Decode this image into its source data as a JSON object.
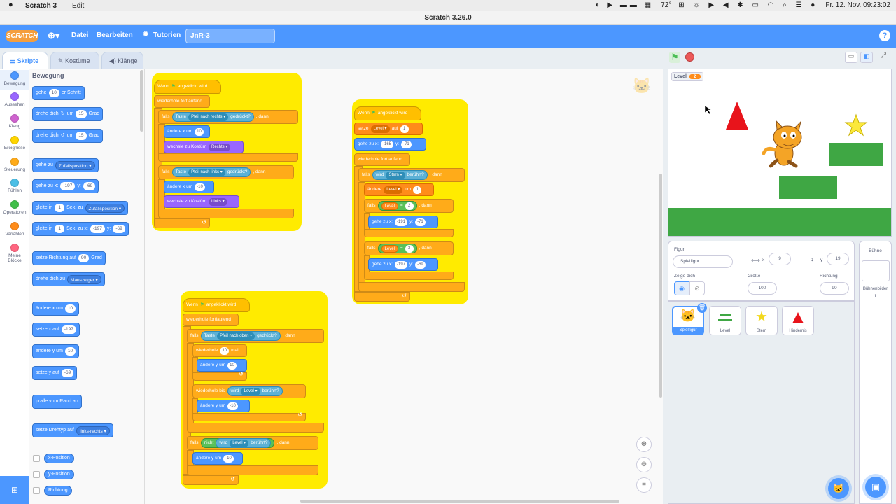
{
  "mac": {
    "app": "Scratch 3",
    "edit": "Edit",
    "weather": "72°",
    "clock": "Fr. 12. Nov.  09:23:02"
  },
  "window": {
    "title": "Scratch 3.26.0"
  },
  "menu": {
    "logo": "SCRATCH",
    "file": "Datei",
    "edit": "Bearbeiten",
    "tutorials": "Tutorien",
    "project_title": "JnR-3",
    "help": "?"
  },
  "tabs": {
    "code": "Skripte",
    "costumes": "Kostüme",
    "sounds": "Klänge"
  },
  "categories": [
    {
      "label": "Bewegung",
      "color": "#4c97ff"
    },
    {
      "label": "Aussehen",
      "color": "#9966ff"
    },
    {
      "label": "Klang",
      "color": "#cf63cf"
    },
    {
      "label": "Ereignisse",
      "color": "#ffd500"
    },
    {
      "label": "Steuerung",
      "color": "#ffab19"
    },
    {
      "label": "Fühlen",
      "color": "#4cbfe6"
    },
    {
      "label": "Operatoren",
      "color": "#40bf4a"
    },
    {
      "label": "Variablen",
      "color": "#ff8c1a"
    },
    {
      "label": "Meine Blöcke",
      "color": "#ff6680"
    }
  ],
  "palette": {
    "heading": "Bewegung",
    "move": {
      "a": "gehe",
      "v": "10",
      "b": "er Schritt"
    },
    "turn_right": {
      "a": "drehe dich",
      "b": "um",
      "v": "15",
      "c": "Grad"
    },
    "turn_left": {
      "a": "drehe dich",
      "b": "um",
      "v": "15",
      "c": "Grad"
    },
    "goto": {
      "a": "gehe zu",
      "dd": "Zufallsposition"
    },
    "gotoxy": {
      "a": "gehe zu x:",
      "x": "-197",
      "b": "y:",
      "y": "-69"
    },
    "glide": {
      "a": "gleite in",
      "v": "1",
      "b": "Sek. zu",
      "dd": "Zufallsposition"
    },
    "glidexy": {
      "a": "gleite in",
      "v": "1",
      "b": "Sek. zu x:",
      "x": "-197",
      "c": "y:",
      "y": "-69"
    },
    "point": {
      "a": "setze Richtung auf",
      "v": "90",
      "b": "Grad"
    },
    "pointto": {
      "a": "drehe dich zu",
      "dd": "Mauszeiger"
    },
    "changex": {
      "a": "ändere x um",
      "v": "10"
    },
    "setx": {
      "a": "setze x auf",
      "v": "-197"
    },
    "changey": {
      "a": "ändere y um",
      "v": "10"
    },
    "sety": {
      "a": "setze y auf",
      "v": "-69"
    },
    "bounce": "pralle vom Rand ab",
    "rotstyle": {
      "a": "setze Drehtyp auf",
      "dd": "links-rechts"
    },
    "rep_x": "x-Position",
    "rep_y": "y-Position",
    "rep_dir": "Richtung"
  },
  "scripts": {
    "s1": {
      "hat": "Wenn",
      "hat2": "angeklickt wird",
      "forever": "wiederhole fortlaufend",
      "if1": {
        "a": "falls",
        "b": "Taste",
        "dd": "Pfeil nach rechts",
        "c": "gedrückt?",
        "d": ", dann"
      },
      "cx1": {
        "a": "ändere x um",
        "v": "10"
      },
      "cos1": {
        "a": "wechsle zu Kostüm",
        "dd": "Rechts"
      },
      "if2": {
        "a": "falls",
        "b": "Taste",
        "dd": "Pfeil nach links",
        "c": "gedrückt?",
        "d": ", dann"
      },
      "cx2": {
        "a": "ändere x um",
        "v": "-10"
      },
      "cos2": {
        "a": "wechsle zu Kostüm",
        "dd": "Links"
      }
    },
    "s2": {
      "hat": "Wenn",
      "hat2": "angeklickt wird",
      "set": {
        "a": "setze",
        "dd": "Level",
        "b": "auf",
        "v": "1"
      },
      "goto": {
        "a": "gehe zu x:",
        "x": "-165",
        "b": "y:",
        "y": "-71"
      },
      "forever": "wiederhole fortlaufend",
      "if1": {
        "a": "falls",
        "b": "wird",
        "dd": "Stern",
        "c": "berührt?",
        "d": ", dann"
      },
      "change": {
        "a": "ändere",
        "dd": "Level",
        "b": "um",
        "v": "1"
      },
      "if2": {
        "a": "falls",
        "var": "Level",
        "eq": "=",
        "v": "2",
        "d": ", dann"
      },
      "goto2": {
        "a": "gehe zu x:",
        "x": "-191",
        "b": "y:",
        "y": "-71"
      },
      "if3": {
        "a": "falls",
        "var": "Level",
        "eq": "=",
        "v": "3",
        "d": ", dann"
      },
      "goto3": {
        "a": "gehe zu x:",
        "x": "-197",
        "b": "y:",
        "y": "-69"
      }
    },
    "s3": {
      "hat": "Wenn",
      "hat2": "angeklickt wird",
      "forever": "wiederhole fortlaufend",
      "if1": {
        "a": "falls",
        "b": "Taste",
        "dd": "Pfeil nach oben",
        "c": "gedrückt?",
        "d": ", dann"
      },
      "repeat": {
        "a": "wiederhole",
        "v": "10",
        "b": "mal"
      },
      "cy1": {
        "a": "ändere y um",
        "v": "10"
      },
      "until": {
        "a": "wiederhole bis",
        "b": "wird",
        "dd": "Level",
        "c": "berührt?"
      },
      "cy2": {
        "a": "ändere y um",
        "v": "-10"
      },
      "if2": {
        "a": "falls",
        "not": "nicht",
        "b": "wird",
        "dd": "Level",
        "c": "berührt?",
        "d": ", dann"
      },
      "cy3": {
        "a": "ändere y um",
        "v": "-10"
      }
    }
  },
  "stage": {
    "monitor_label": "Level",
    "monitor_value": "2"
  },
  "sprite_info": {
    "sprite_label": "Figur",
    "sprite_name": "Spielfigur",
    "x_label": "x",
    "x": "9",
    "y_label": "y",
    "y": "19",
    "show_label": "Zeige dich",
    "size_label": "Größe",
    "size": "100",
    "dir_label": "Richtung",
    "dir": "90"
  },
  "sprites": [
    {
      "name": "Spielfigur"
    },
    {
      "name": "Level"
    },
    {
      "name": "Stern"
    },
    {
      "name": "Hindernis"
    }
  ],
  "stage_panel": {
    "title": "Bühne",
    "backdrops_label": "Bühnenbilder",
    "backdrops_count": "1"
  }
}
